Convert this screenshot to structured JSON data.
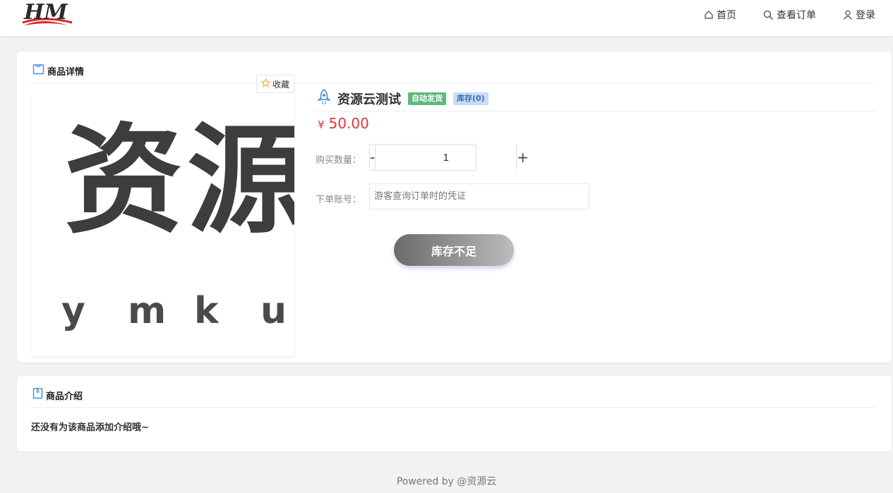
{
  "header": {
    "logo_text": "HM",
    "nav": [
      {
        "label": "首页",
        "icon": "home-icon"
      },
      {
        "label": "查看订单",
        "icon": "search-icon"
      },
      {
        "label": "登录",
        "icon": "user-icon"
      }
    ]
  },
  "detail": {
    "title": "商品详情",
    "favorite_label": "收藏",
    "image_text": "资源",
    "image_subtext": [
      "y",
      "m",
      "k",
      "u"
    ],
    "product_name": "资源云测试",
    "badge_auto": "自动发货",
    "badge_stock": "库存(0)",
    "currency": "¥",
    "price": "50.00",
    "qty_label": "购买数量：",
    "qty_minus": "-",
    "qty_value": "1",
    "qty_plus": "+",
    "account_label": "下单账号：",
    "account_placeholder": "游客查询订单时的凭证",
    "stock_button": "库存不足"
  },
  "intro": {
    "title": "商品介绍",
    "text": "还没有为该商品添加介绍哦~"
  },
  "footer": {
    "text": "Powered by @资源云"
  },
  "colors": {
    "price": "#e2383c",
    "badge_auto": "#5fb878",
    "badge_stock": "#c9dcf5",
    "accent_icon": "#4a90d9"
  }
}
